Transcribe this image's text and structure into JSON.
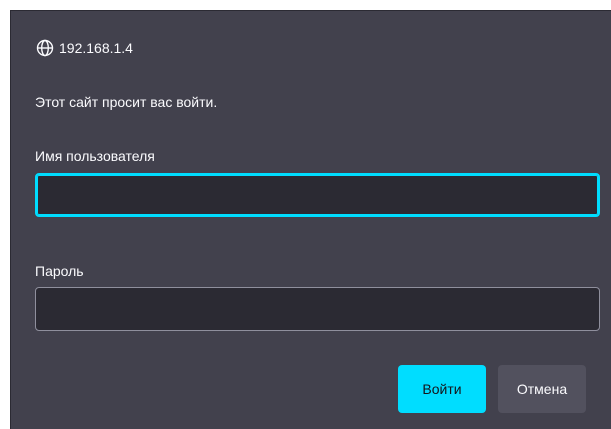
{
  "dialog": {
    "origin": "192.168.1.4",
    "origin_icon": "globe-icon",
    "message": "Этот сайт просит вас войти.",
    "username": {
      "label": "Имя пользователя",
      "value": "",
      "placeholder": ""
    },
    "password": {
      "label": "Пароль",
      "value": "",
      "placeholder": ""
    },
    "buttons": {
      "login": "Войти",
      "cancel": "Отмена"
    }
  },
  "colors": {
    "dialog_bg": "#42414d",
    "input_bg": "#2b2a33",
    "accent": "#00ddff",
    "text": "#fbfbfe",
    "secondary_button": "#52515e"
  }
}
